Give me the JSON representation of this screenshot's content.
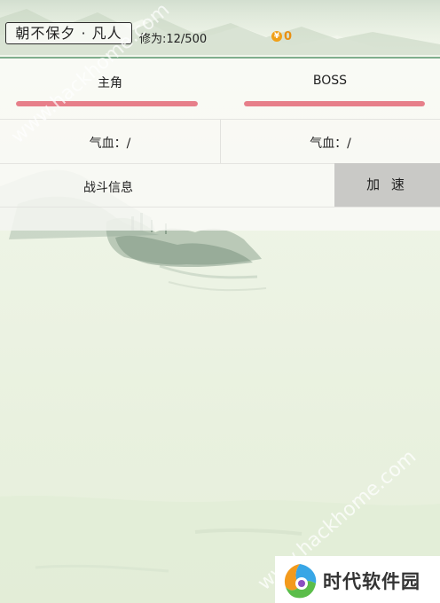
{
  "header": {
    "title_label": "朝不保夕 · 凡人",
    "cultivation_text": "修为:12/500",
    "coin_icon": "yen-coin-icon",
    "coin_symbol": "¥",
    "coin_value": "0"
  },
  "battle": {
    "hero": {
      "label": "主角",
      "hp_text": "气血：/",
      "hp_fraction": 1.0
    },
    "boss": {
      "label": "BOSS",
      "hp_text": "气血：/",
      "hp_fraction": 1.0
    },
    "info_label": "战斗信息",
    "speed_button_label": "加 速"
  },
  "watermarks": {
    "top": "www.hackhome.com",
    "bottom": "www.hackhome.com"
  },
  "logo": {
    "text": "时代软件园",
    "icon": "colorful-flame-logo-icon"
  },
  "colors": {
    "hp_fill": "#e77f8a",
    "coin": "#f0a018",
    "divider": "#7fae8c",
    "speed_button_bg": "#c9c9c6"
  }
}
